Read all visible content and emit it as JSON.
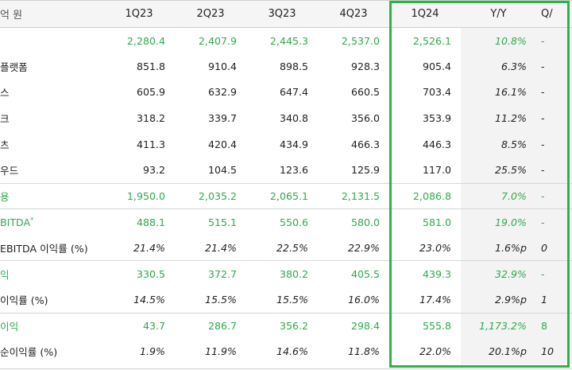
{
  "header": {
    "unit": "억 원",
    "columns": [
      "1Q23",
      "2Q23",
      "3Q23",
      "4Q23",
      "1Q24",
      "Y/Y",
      "Q/"
    ]
  },
  "rows": [
    {
      "label": "",
      "values": [
        "2,280.4",
        "2,407.9",
        "2,445.3",
        "2,537.0",
        "2,526.1",
        "10.8%",
        "-"
      ],
      "green": true,
      "italic": false,
      "sep": false
    },
    {
      "label": "플랫폼",
      "values": [
        "851.8",
        "910.4",
        "898.5",
        "928.3",
        "905.4",
        "6.3%",
        "-"
      ],
      "green": false,
      "italic": false,
      "sep": false
    },
    {
      "label": "스",
      "values": [
        "605.9",
        "632.9",
        "647.4",
        "660.5",
        "703.4",
        "16.1%",
        "-"
      ],
      "green": false,
      "italic": false,
      "sep": false
    },
    {
      "label": "크",
      "values": [
        "318.2",
        "339.7",
        "340.8",
        "356.0",
        "353.9",
        "11.2%",
        "-"
      ],
      "green": false,
      "italic": false,
      "sep": false
    },
    {
      "label": "츠",
      "values": [
        "411.3",
        "420.4",
        "434.9",
        "466.3",
        "446.3",
        "8.5%",
        "-"
      ],
      "green": false,
      "italic": false,
      "sep": false
    },
    {
      "label": "우드",
      "values": [
        "93.2",
        "104.5",
        "123.6",
        "125.9",
        "117.0",
        "25.5%",
        "-"
      ],
      "green": false,
      "italic": false,
      "sep": false
    },
    {
      "label": "용",
      "values": [
        "1,950.0",
        "2,035.2",
        "2,065.1",
        "2,131.5",
        "2,086.8",
        "7.0%",
        "-"
      ],
      "green": true,
      "italic": false,
      "sep": true
    },
    {
      "label": "BITDA",
      "labelSup": "*",
      "values": [
        "488.1",
        "515.1",
        "550.6",
        "580.0",
        "581.0",
        "19.0%",
        "-"
      ],
      "green": true,
      "italic": false,
      "sep": true
    },
    {
      "label": "EBITDA 이익률 (%)",
      "values": [
        "21.4%",
        "21.4%",
        "22.5%",
        "22.9%",
        "23.0%",
        "1.6%p",
        "0"
      ],
      "green": false,
      "italic": true,
      "sep": false
    },
    {
      "label": "익",
      "values": [
        "330.5",
        "372.7",
        "380.2",
        "405.5",
        "439.3",
        "32.9%",
        "-"
      ],
      "green": true,
      "italic": false,
      "sep": true
    },
    {
      "label": "이익률 (%)",
      "values": [
        "14.5%",
        "15.5%",
        "15.5%",
        "16.0%",
        "17.4%",
        "2.9%p",
        "1"
      ],
      "green": false,
      "italic": true,
      "sep": false
    },
    {
      "label": "이익",
      "values": [
        "43.7",
        "286.7",
        "356.2",
        "298.4",
        "555.8",
        "1,173.2%",
        "8"
      ],
      "green": true,
      "italic": false,
      "sep": true
    },
    {
      "label": "순이익률 (%)",
      "values": [
        "1.9%",
        "11.9%",
        "14.6%",
        "11.8%",
        "22.0%",
        "20.1%p",
        "10"
      ],
      "green": false,
      "italic": true,
      "sep": false
    }
  ]
}
